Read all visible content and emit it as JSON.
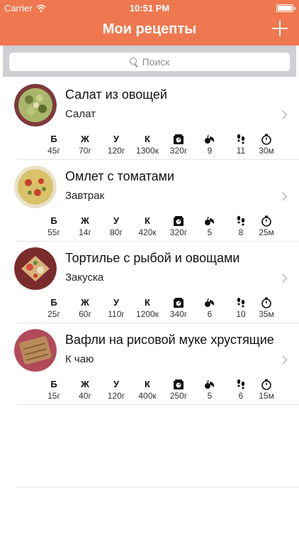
{
  "status_bar": {
    "carrier": "Carrier",
    "time": "10:51 PM"
  },
  "nav": {
    "title": "Мои рецепты",
    "add_icon": "plus-icon"
  },
  "search": {
    "placeholder": "Поиск"
  },
  "stat_labels": {
    "protein": "Б",
    "fat": "Ж",
    "carbs": "У",
    "kcal": "К"
  },
  "recipes": [
    {
      "name": "Салат из овощей",
      "category": "Салат",
      "protein": "45г",
      "fat": "70г",
      "carbs": "120г",
      "kcal": "1300к",
      "weight": "320г",
      "ingredients": "9",
      "steps": "11",
      "time": "30м"
    },
    {
      "name": "Омлет с томатами",
      "category": "Завтрак",
      "protein": "55г",
      "fat": "14г",
      "carbs": "80г",
      "kcal": "420к",
      "weight": "320г",
      "ingredients": "5",
      "steps": "8",
      "time": "25м"
    },
    {
      "name": "Тортилье с рыбой и овощами",
      "category": "Закуска",
      "protein": "25г",
      "fat": "60г",
      "carbs": "110г",
      "kcal": "1200к",
      "weight": "340г",
      "ingredients": "6",
      "steps": "10",
      "time": "35м"
    },
    {
      "name": "Вафли на рисовой муке хрустящие",
      "category": "К чаю",
      "protein": "15г",
      "fat": "40г",
      "carbs": "120г",
      "kcal": "400к",
      "weight": "250г",
      "ingredients": "5",
      "steps": "6",
      "time": "15м"
    }
  ],
  "colors": {
    "accent": "#ef7850",
    "search_bar": "#cfcfd4",
    "separator": "#e4e4e6"
  }
}
